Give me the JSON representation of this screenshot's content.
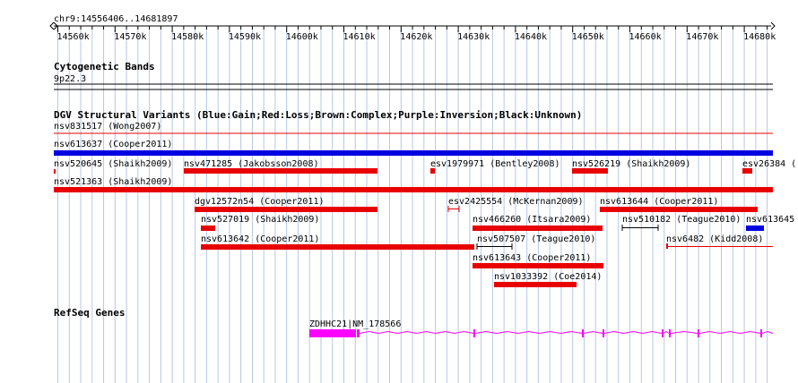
{
  "ruler": {
    "coords": "chr9:14556406..14681897",
    "ticks": [
      "14560k",
      "14570k",
      "14580k",
      "14590k",
      "14600k",
      "14610k",
      "14620k",
      "14630k",
      "14640k",
      "14650k",
      "14660k",
      "14670k",
      "14680k"
    ]
  },
  "tracks": {
    "cyto": {
      "title": "Cytogenetic Bands",
      "band": "9p22.3"
    },
    "dgv": {
      "title": "DGV Structural Variants (Blue:Gain;Red:Loss;Brown:Complex;Purple:Inversion;Black:Unknown)",
      "features": [
        {
          "label": "nsv831517 (Wong2007)",
          "color": "#e80000",
          "kind": "line"
        },
        {
          "label": "nsv613637 (Cooper2011)",
          "color": "#0000e0",
          "kind": "bar"
        },
        {
          "label": "nsv520645 (Shaikh2009)",
          "color": "#e80000",
          "kind": "tick"
        },
        {
          "label": "nsv471285 (Jakobsson2008)",
          "color": "#e80000",
          "kind": "bar"
        },
        {
          "label": "esv1979971 (Bentley2008)",
          "color": "#e80000",
          "kind": "bar"
        },
        {
          "label": "nsv526219 (Shaikh2009)",
          "color": "#e80000",
          "kind": "bar"
        },
        {
          "label": "esv26384 (",
          "color": "#e80000",
          "kind": "bar"
        },
        {
          "label": "nsv521363 (Shaikh2009)",
          "color": "#e80000",
          "kind": "bar"
        },
        {
          "label": "dgv12572n54 (Cooper2011)",
          "color": "#e80000",
          "kind": "bar"
        },
        {
          "label": "esv2425554 (McKernan2009)",
          "color": "#e80000",
          "kind": "bracket"
        },
        {
          "label": "nsv613644 (Cooper2011)",
          "color": "#e80000",
          "kind": "bar"
        },
        {
          "label": "nsv527019 (Shaikh2009)",
          "color": "#e80000",
          "kind": "bar"
        },
        {
          "label": "nsv466260 (Itsara2009)",
          "color": "#e80000",
          "kind": "bar"
        },
        {
          "label": "nsv510182 (Teague2010)",
          "color": "#000000",
          "kind": "bracket"
        },
        {
          "label": "nsv613645",
          "color": "#0000e0",
          "kind": "bar"
        },
        {
          "label": "nsv613642 (Cooper2011)",
          "color": "#e80000",
          "kind": "bar"
        },
        {
          "label": "nsv507507 (Teague2010)",
          "color": "#000000",
          "kind": "bracket"
        },
        {
          "label": "nsv6482 (Kidd2008)",
          "color": "#e80000",
          "kind": "line"
        },
        {
          "label": "nsv613643 (Cooper2011)",
          "color": "#e80000",
          "kind": "bar"
        },
        {
          "label": "nsv1033392 (Coe2014)",
          "color": "#e80000",
          "kind": "bar"
        }
      ]
    },
    "refseq": {
      "title": "RefSeq Genes",
      "gene_label": "ZDHHC21|NM_178566",
      "color": "#ff00ff"
    }
  },
  "colors": {
    "gridline": "#b4c8e6",
    "gain": "#0000e0",
    "loss": "#e80000",
    "unknown": "#000000",
    "gene": "#ff00ff"
  }
}
